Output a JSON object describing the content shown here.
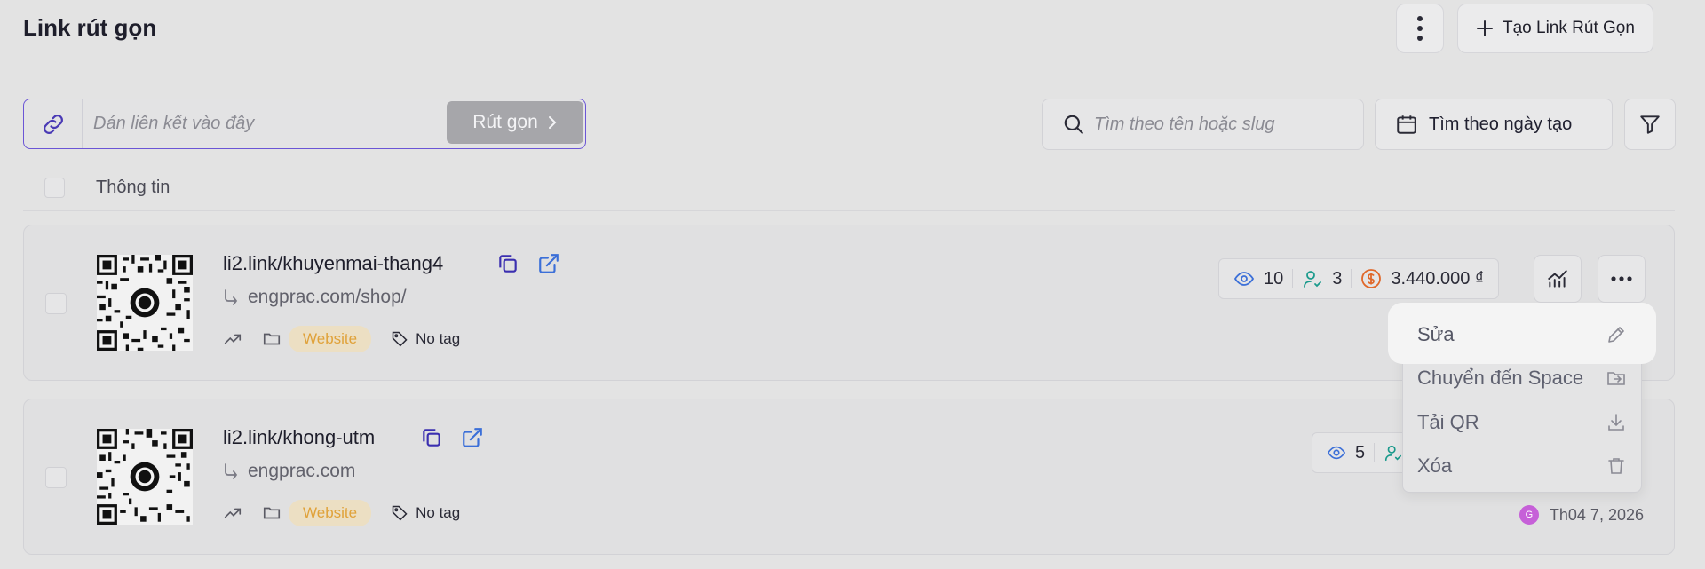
{
  "header": {
    "title": "Link rút gọn",
    "create_label": "Tạo Link Rút Gọn"
  },
  "shorten": {
    "placeholder": "Dán liên kết vào đây",
    "button_label": "Rút gọn"
  },
  "search": {
    "placeholder": "Tìm theo tên hoặc slug"
  },
  "date_filter": {
    "label": "Tìm theo ngày tạo"
  },
  "table": {
    "column_info": "Thông tin"
  },
  "links": [
    {
      "short": "li2.link/khuyenmai-thang4",
      "destination": "engprac.com/shop/",
      "tag": "Website",
      "tags_text": "No tag",
      "views": "10",
      "users": "3",
      "revenue": "3.440.000 ₫"
    },
    {
      "short": "li2.link/khong-utm",
      "destination": "engprac.com",
      "tag": "Website",
      "tags_text": "No tag",
      "views": "5",
      "avatar_letter": "G",
      "date": "Th04 7, 2026"
    }
  ],
  "menu": {
    "items": [
      "Sửa",
      "Chuyển đến Space",
      "Tải QR",
      "Xóa"
    ]
  },
  "colors": {
    "accent": "#6b55d6",
    "link_blue": "#3b6fd8",
    "copy_icon": "#3b2fb0",
    "user_icon": "#1a9a8c",
    "revenue_icon": "#e0682a",
    "tag_bg": "#ecdfc3",
    "tag_text": "#e0a23a",
    "avatar": "#c660d8"
  }
}
